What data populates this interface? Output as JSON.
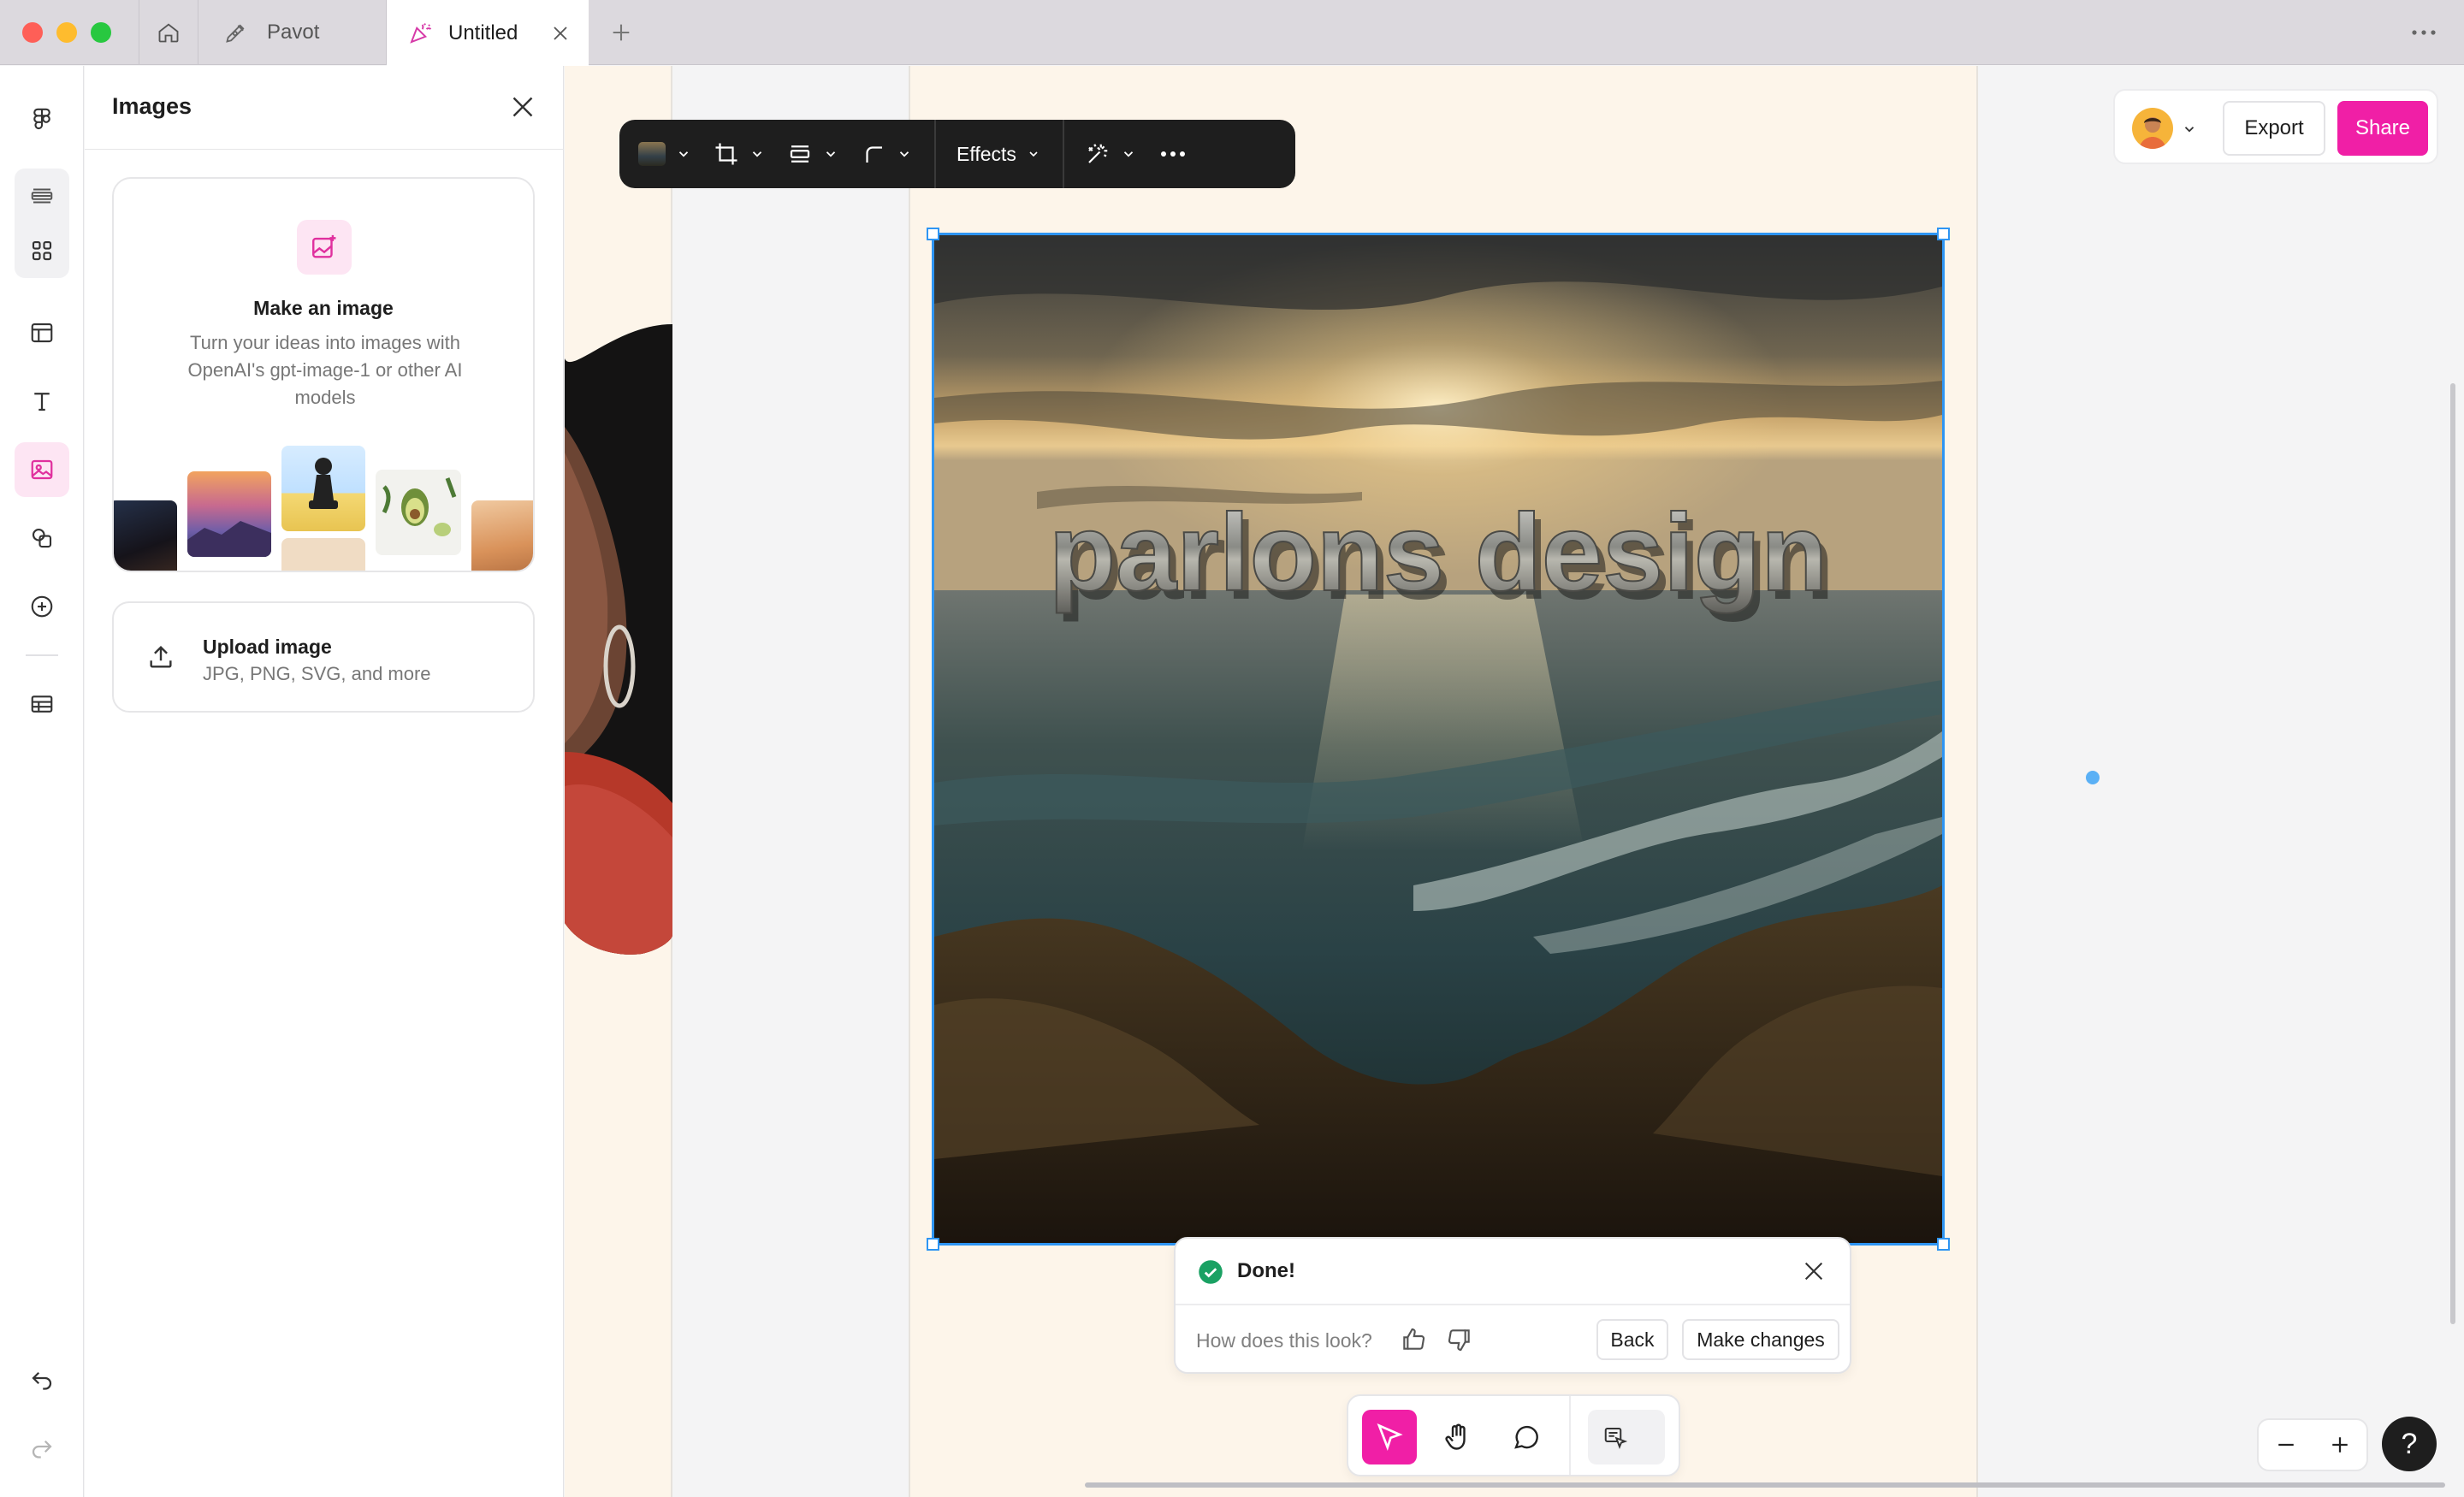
{
  "window": {
    "tabs": [
      {
        "label": "Pavot"
      },
      {
        "label": "Untitled"
      }
    ]
  },
  "panel": {
    "title": "Images",
    "make": {
      "title": "Make an image",
      "description": "Turn your ideas into images with OpenAI's gpt-image-1 or other AI models"
    },
    "upload": {
      "title": "Upload image",
      "subtitle": "JPG, PNG, SVG, and more"
    }
  },
  "toolbar": {
    "effects_label": "Effects"
  },
  "image": {
    "overlay_text": "parlons design"
  },
  "feedback": {
    "status": "Done!",
    "question": "How does this look?",
    "back_label": "Back",
    "make_changes_label": "Make changes"
  },
  "header": {
    "export_label": "Export",
    "share_label": "Share"
  },
  "help": {
    "label": "?"
  },
  "colors": {
    "accent": "#f01fa6",
    "selection": "#2e95f3",
    "success": "#1aa163",
    "frame_bg": "#fdf5ea"
  },
  "icons": [
    "home-icon",
    "pen-tool-icon",
    "confetti-icon",
    "close-icon",
    "plus-icon",
    "more-icon",
    "figma-logo-icon",
    "layers-icon",
    "assets-icon",
    "frame-icon",
    "text-icon",
    "image-icon",
    "shapes-icon",
    "add-circle-icon",
    "table-icon",
    "undo-icon",
    "redo-icon",
    "image-sparkle-icon",
    "upload-icon",
    "crop-icon",
    "align-icon",
    "corner-radius-icon",
    "chevron-down-icon",
    "magic-wand-icon",
    "check-circle-icon",
    "thumbs-up-icon",
    "thumbs-down-icon",
    "move-cursor-icon",
    "hand-icon",
    "comment-icon",
    "dev-mode-icon",
    "minus-icon",
    "help-icon"
  ]
}
